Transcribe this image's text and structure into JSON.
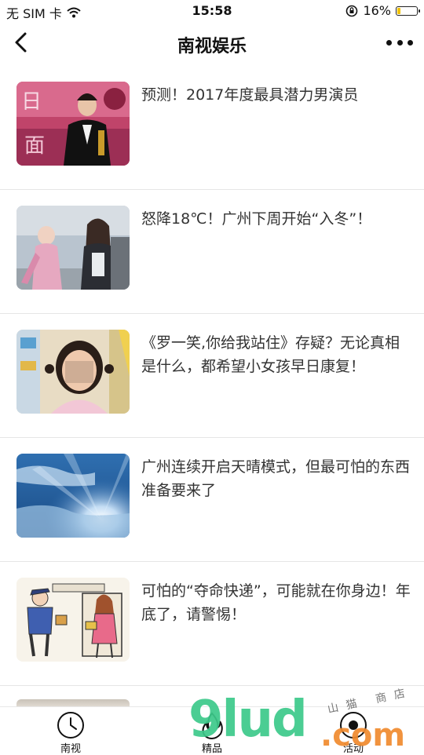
{
  "status_bar": {
    "carrier": "无 SIM 卡",
    "time": "15:58",
    "battery": "16%",
    "battery_level": 0.16,
    "battery_color": "#f2c200"
  },
  "nav": {
    "title": "南视娱乐",
    "back_icon": "chevron-left-icon",
    "more_icon": "more-dots-icon"
  },
  "articles": [
    {
      "title": "预测！2017年度最具潜力男演员"
    },
    {
      "title": "怒降18℃！广州下周开始“入冬”！"
    },
    {
      "title": "《罗一笑,你给我站住》存疑？无论真相是什么，都希望小女孩早日康复！"
    },
    {
      "title": "广州连续开启天晴模式，但最可怕的东西准备要来了"
    },
    {
      "title": "可怕的“夺命快递”，可能就在你身边！年底了，请警惕！"
    }
  ],
  "tabs": [
    {
      "label": "南视",
      "icon": "clock-icon"
    },
    {
      "label": "精品",
      "icon": "flame-icon"
    },
    {
      "label": "活动",
      "icon": "target-icon"
    }
  ],
  "watermark": {
    "main": "9lud",
    "suffix": ".com",
    "small": "山猫 商店"
  }
}
